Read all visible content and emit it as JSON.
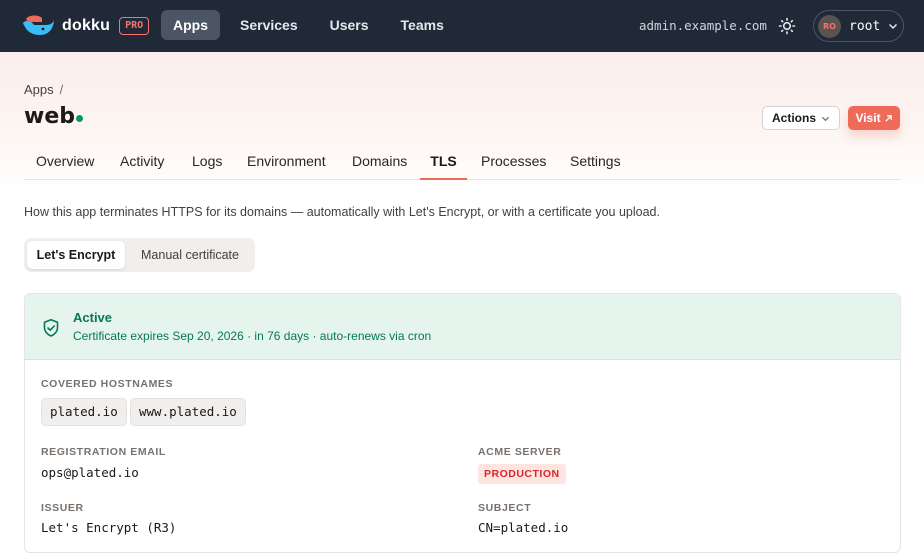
{
  "nav": {
    "brand": "dokku",
    "badge": "PRO",
    "items": [
      {
        "label": "Apps",
        "active": true
      },
      {
        "label": "Services",
        "active": false
      },
      {
        "label": "Users",
        "active": false
      },
      {
        "label": "Teams",
        "active": false
      }
    ],
    "host": "admin.example.com",
    "theme_icon": "sun-icon",
    "user": {
      "initials": "RO",
      "name": "root"
    }
  },
  "header": {
    "breadcrumb": "Apps",
    "breadcrumb_sep": "/",
    "title": "web",
    "status_color": "#059669",
    "actions_label": "Actions",
    "visit_label": "Visit",
    "visit_icon": "external-link-icon"
  },
  "tabs": [
    {
      "label": "Overview"
    },
    {
      "label": "Activity"
    },
    {
      "label": "Logs"
    },
    {
      "label": "Environment"
    },
    {
      "label": "Domains"
    },
    {
      "label": "TLS",
      "active": true
    },
    {
      "label": "Processes"
    },
    {
      "label": "Settings"
    }
  ],
  "intro": "How this app terminates HTTPS for its domains — automatically with Let's Encrypt, or with a certificate you upload.",
  "mode": {
    "options": [
      "Let's Encrypt",
      "Manual certificate"
    ],
    "selected": "Let's Encrypt"
  },
  "certificate": {
    "status": "Active",
    "detail": "Certificate expires Sep 20, 2026 · in 76 days · auto-renews via cron",
    "hostnames_label": "COVERED HOSTNAMES",
    "hostnames": [
      "plated.io",
      "www.plated.io"
    ],
    "email_label": "REGISTRATION EMAIL",
    "email": "ops@plated.io",
    "acme_label": "ACME SERVER",
    "acme": "PRODUCTION",
    "issuer_label": "ISSUER",
    "issuer": "Let's Encrypt (R3)",
    "subject_label": "SUBJECT",
    "subject": "CN=plated.io"
  },
  "colors": {
    "topbar": "#1f2937",
    "accent": "#ef6b59",
    "success": "#047857",
    "success_bg": "#e6f4ee"
  }
}
